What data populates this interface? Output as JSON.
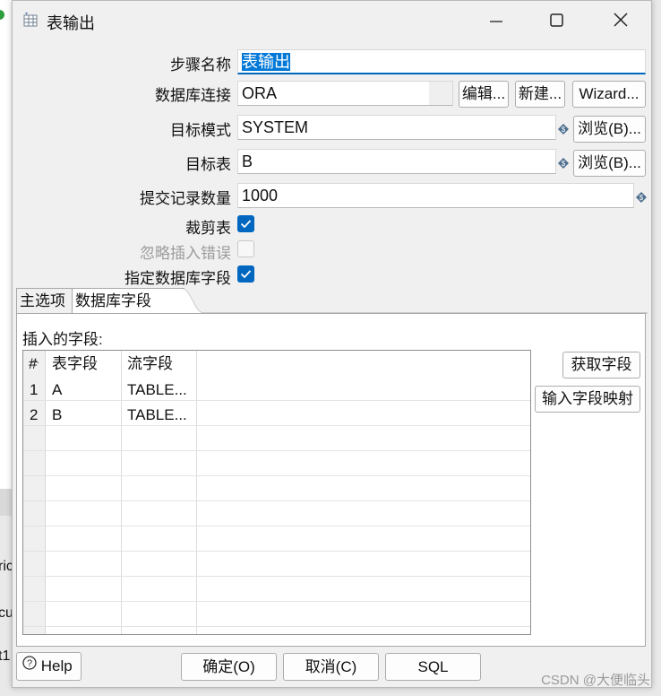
{
  "window": {
    "title": "表输出",
    "controls": {
      "minimize_icon": "minimize-icon",
      "maximize_icon": "maximize-icon",
      "close_icon": "close-icon"
    }
  },
  "form": {
    "step_name": {
      "label": "步骤名称",
      "value": "表输出"
    },
    "connection": {
      "label": "数据库连接",
      "value": "ORA",
      "edit_label": "编辑...",
      "new_label": "新建...",
      "wizard_label": "Wizard..."
    },
    "target_schema": {
      "label": "目标模式",
      "value": "SYSTEM",
      "browse_label": "浏览(B)..."
    },
    "target_table": {
      "label": "目标表",
      "value": "B",
      "browse_label": "浏览(B)..."
    },
    "commit_size": {
      "label": "提交记录数量",
      "value": "1000"
    },
    "truncate_table": {
      "label": "裁剪表",
      "checked": true
    },
    "ignore_insert_errors": {
      "label": "忽略插入错误",
      "checked": false
    },
    "specify_db_fields": {
      "label": "指定数据库字段",
      "checked": true
    }
  },
  "tabs": [
    {
      "label": "主选项",
      "active": false
    },
    {
      "label": "数据库字段",
      "active": true
    }
  ],
  "fields_panel": {
    "heading": "插入的字段:",
    "columns": [
      "#",
      "表字段",
      "流字段"
    ],
    "rows": [
      {
        "num": "1",
        "table_field": "A",
        "stream_field": "TABLE..."
      },
      {
        "num": "2",
        "table_field": "B",
        "stream_field": "TABLE..."
      }
    ],
    "get_fields_label": "获取字段",
    "input_mapping_label": "输入字段映射"
  },
  "footer": {
    "help_label": "Help",
    "ok_label": "确定(O)",
    "cancel_label": "取消(C)",
    "sql_label": "SQL"
  },
  "background": {
    "peek_texts": [
      "ric",
      "cu",
      "t1"
    ]
  },
  "watermark": "CSDN @大便临头",
  "colors": {
    "accent": "#0067c0",
    "selection": "#0078d7"
  }
}
